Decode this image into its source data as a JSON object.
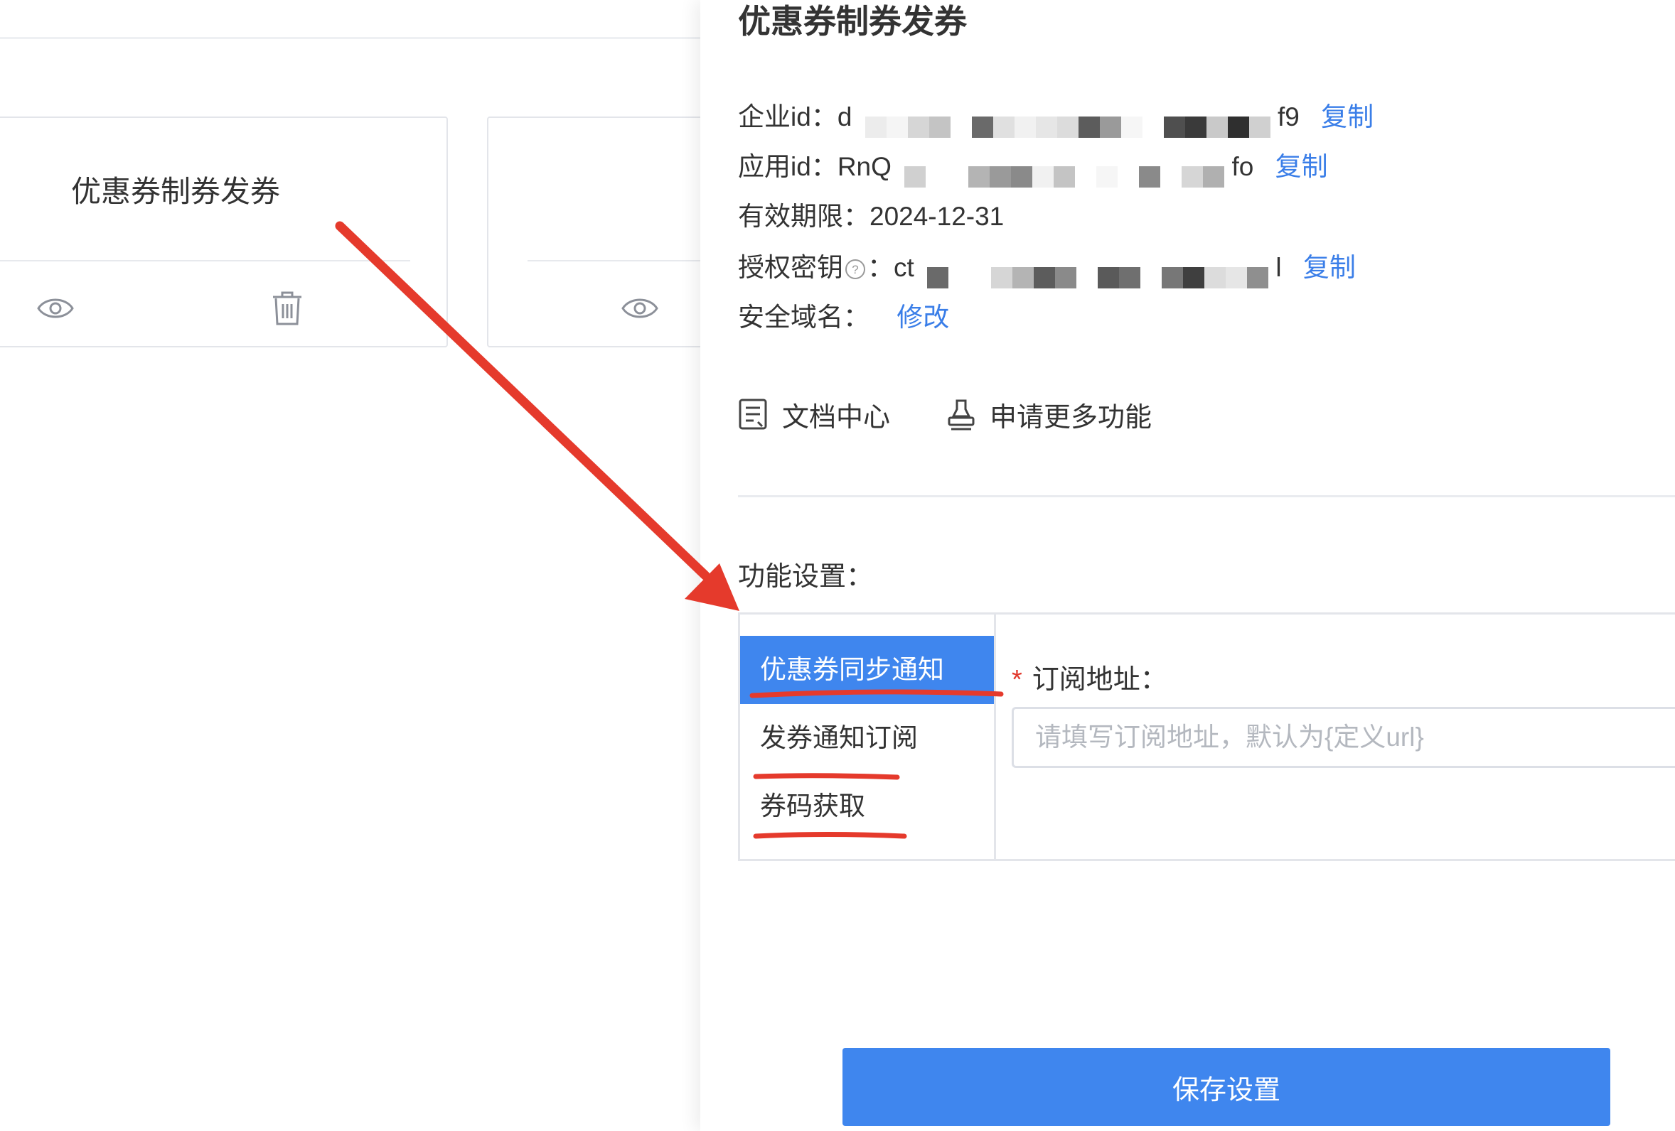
{
  "background": {
    "card_title": "优惠券制券发券",
    "card_icons": [
      "eye-icon",
      "trash-icon"
    ]
  },
  "drawer": {
    "title": "优惠券制券发券",
    "enterprise_id_label": "企业id：",
    "enterprise_id_prefix": "d",
    "enterprise_id_suffix": "f9",
    "app_id_label": "应用id：",
    "app_id_prefix": "RnQ",
    "app_id_suffix": "fo",
    "validity_label": "有效期限：",
    "validity_value": "2024-12-31",
    "auth_key_label": "授权密钥",
    "auth_key_colon": "：",
    "auth_key_prefix": "ct",
    "auth_key_suffix": "l",
    "copy_label": "复制",
    "domain_label": "安全域名：",
    "modify_label": "修改",
    "doc_center": "文档中心",
    "apply_more": "申请更多功能",
    "function_settings_label": "功能设置：",
    "menu": [
      {
        "label": "优惠券同步通知",
        "active": true
      },
      {
        "label": "发券通知订阅",
        "active": false
      },
      {
        "label": "券码获取",
        "active": false
      }
    ],
    "subscribe_label": "订阅地址：",
    "required_mark": "*",
    "subscribe_placeholder": "请填写订阅地址，默认为{定义url}",
    "save_button": "保存设置"
  },
  "colors": {
    "accent": "#3f86ee",
    "link": "#3a7ee8",
    "annotation_red": "#e53a2c",
    "required_red": "#e1382c"
  }
}
